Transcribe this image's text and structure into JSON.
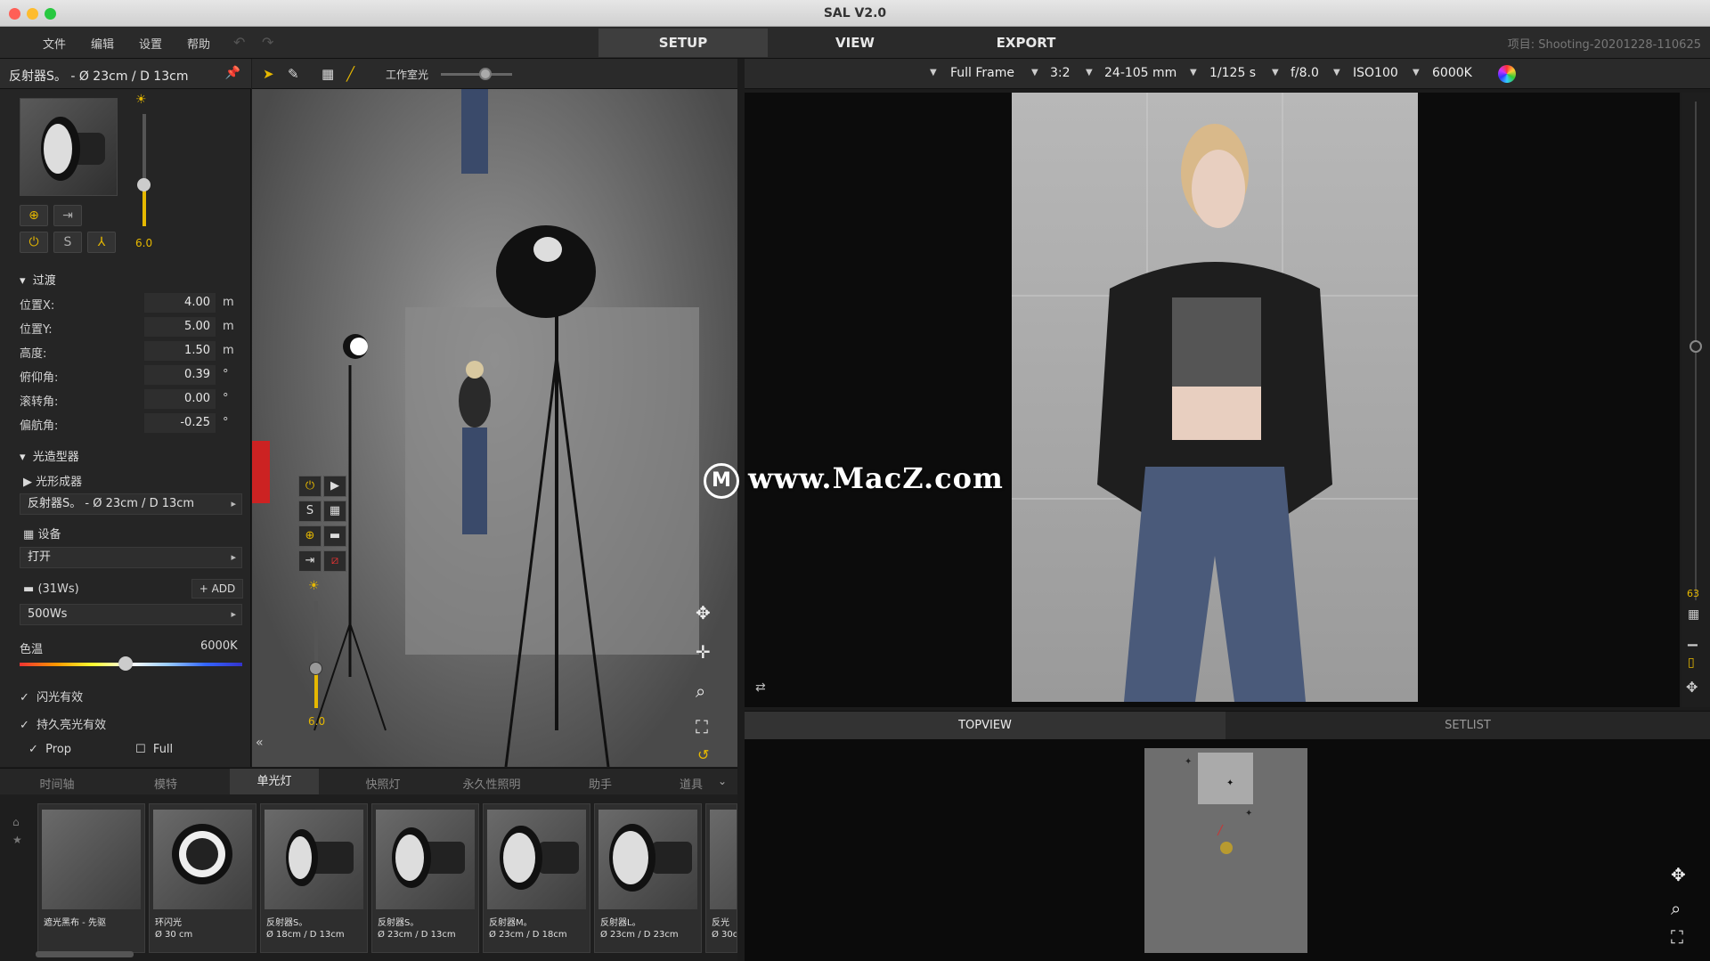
{
  "window": {
    "title": "SAL V2.0"
  },
  "menu": {
    "items": [
      "文件",
      "编辑",
      "设置",
      "帮助"
    ]
  },
  "modes": {
    "setup": "SETUP",
    "view": "VIEW",
    "export": "EXPORT"
  },
  "project": "项目: Shooting-20201228-110625",
  "panel": {
    "title": "反射器S。 - Ø 23cm / D 13cm",
    "intensity": "6.0",
    "section_transition": "过渡",
    "props": [
      {
        "label": "位置X:",
        "value": "4.00",
        "unit": "m"
      },
      {
        "label": "位置Y:",
        "value": "5.00",
        "unit": "m"
      },
      {
        "label": "高度:",
        "value": "1.50",
        "unit": "m"
      },
      {
        "label": "俯仰角:",
        "value": "0.39",
        "unit": "°"
      },
      {
        "label": "滚转角:",
        "value": "0.00",
        "unit": "°"
      },
      {
        "label": "偏航角:",
        "value": "-0.25",
        "unit": "°"
      }
    ],
    "section_modifier": "光造型器",
    "modifier_label": "光形成器",
    "modifier_value": "反射器S。 - Ø 23cm / D 13cm",
    "device_label": "设备",
    "device_value": "打开",
    "power_label": "(31Ws)",
    "add_label": "ADD",
    "power_value": "500Ws",
    "color_temp_label": "色温",
    "color_temp_value": "6000K",
    "flash_enabled": "闪光有效",
    "continuous_enabled": "持久亮光有效",
    "prop_label": "Prop",
    "full_label": "Full"
  },
  "viewport": {
    "workroom_label": "工作室光",
    "light_value": "6.0"
  },
  "library": {
    "tabs": [
      "时间轴",
      "模特",
      "单光灯",
      "快照灯",
      "永久性照明",
      "助手",
      "道具"
    ],
    "active_tab": 2,
    "items": [
      {
        "name": "遮光黑布 - 先驱",
        "size": ""
      },
      {
        "name": "环闪光",
        "size": "Ø 30 cm"
      },
      {
        "name": "反射器S。",
        "size": "Ø 18cm / D 13cm"
      },
      {
        "name": "反射器S。",
        "size": "Ø 23cm / D 13cm"
      },
      {
        "name": "反射器M。",
        "size": "Ø 23cm / D 18cm"
      },
      {
        "name": "反射器L。",
        "size": "Ø 23cm / D 23cm"
      },
      {
        "name": "反光",
        "size": "Ø 30c"
      }
    ]
  },
  "camera": {
    "sensor": "Full Frame",
    "ratio": "3:2",
    "lens": "24-105 mm",
    "shutter": "1/125 s",
    "aperture": "f/8.0",
    "iso": "ISO100",
    "wb": "6000K",
    "zoom_value": "63"
  },
  "views": {
    "topview": "TOPVIEW",
    "setlist": "SETLIST"
  },
  "watermark": "www.MacZ.com"
}
